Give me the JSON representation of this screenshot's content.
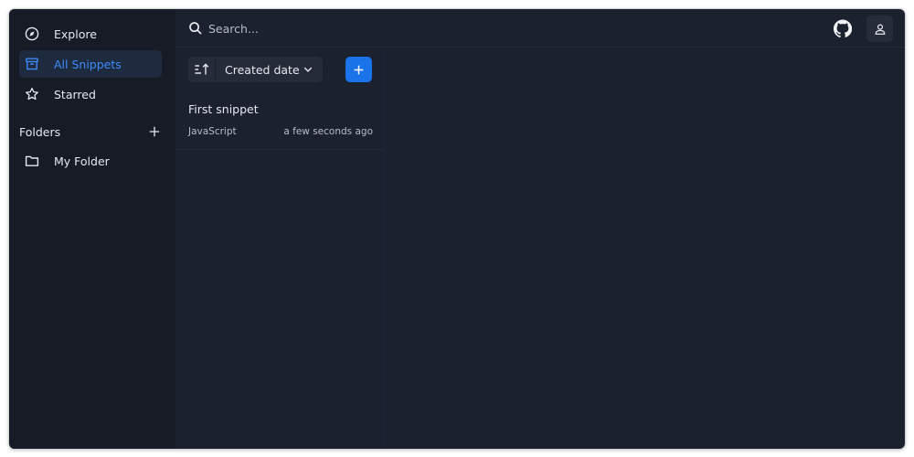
{
  "colors": {
    "accent": "#1a73e8",
    "active_text": "#3d8bfd",
    "sidebar_bg": "#161b26",
    "main_bg": "#1c2130",
    "text": "#e6e8ee",
    "muted_text": "#b8bcc8"
  },
  "sidebar": {
    "items": [
      {
        "label": "Explore",
        "icon": "compass-icon",
        "active": false
      },
      {
        "label": "All Snippets",
        "icon": "archive-icon",
        "active": true
      },
      {
        "label": "Starred",
        "icon": "star-icon",
        "active": false
      }
    ],
    "folders_header": "Folders",
    "folders": [
      {
        "label": "My Folder",
        "icon": "folder-icon"
      }
    ]
  },
  "topbar": {
    "search_placeholder": "Search...",
    "github_icon": "github-icon",
    "user_icon": "user-icon"
  },
  "list": {
    "sort_label": "Created date",
    "sort_dir_icon": "sort-ascending-icon",
    "add_icon": "plus-icon",
    "snippets": [
      {
        "title": "First snippet",
        "language": "JavaScript",
        "time": "a few seconds ago"
      }
    ]
  }
}
